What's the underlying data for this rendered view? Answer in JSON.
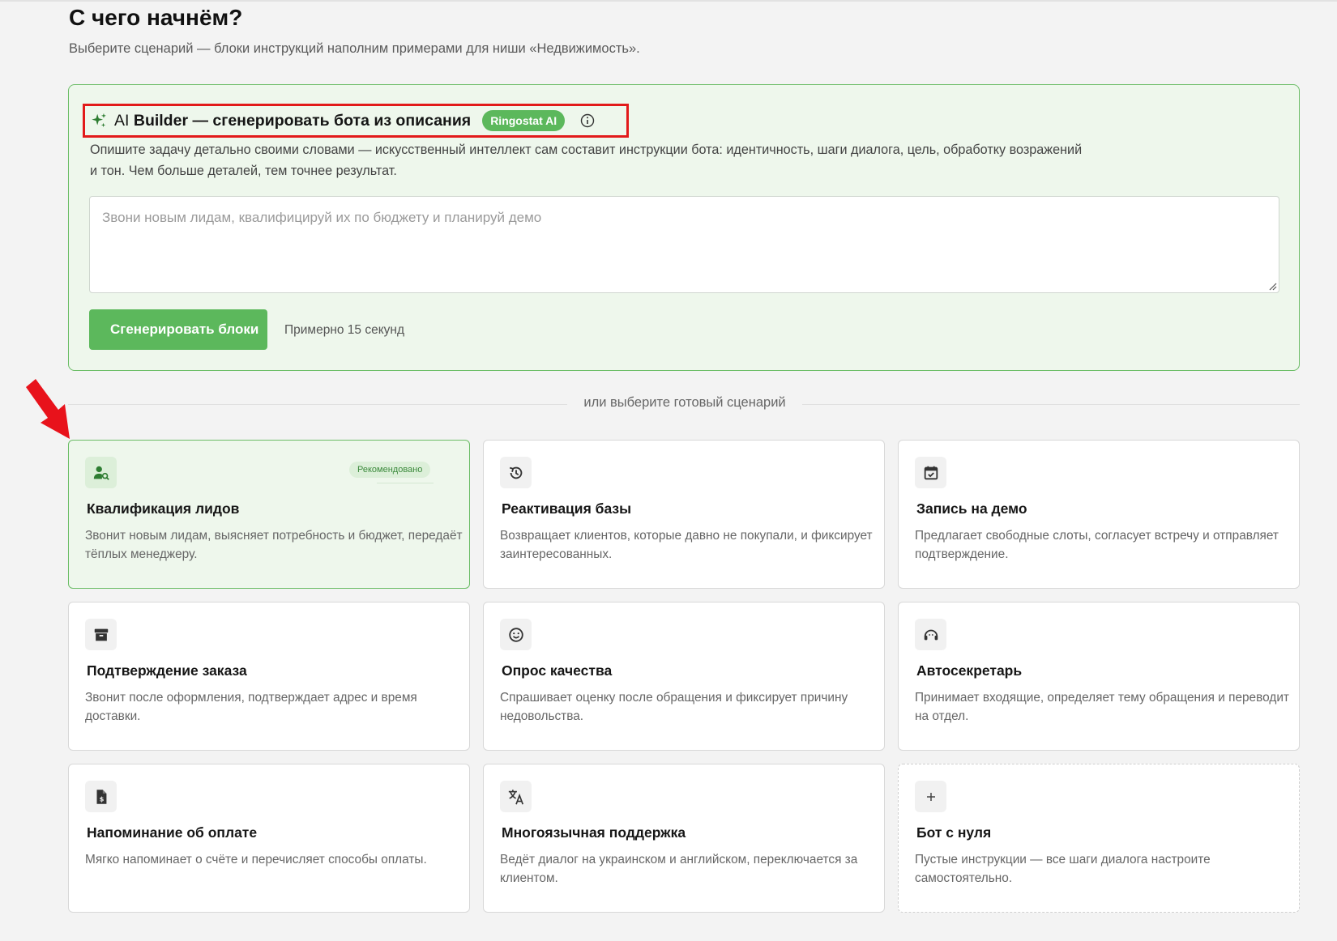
{
  "header": {
    "title": "С чего начнём?",
    "subtitle": "Выберите сценарий — блоки инструкций наполним примерами для ниши «Недвижимость»."
  },
  "ai_builder": {
    "title_prefix": "AI",
    "title_main": " Builder — сгенерировать бота из описания",
    "badge": "Ringostat AI",
    "icon": "sparkle-icon",
    "info_icon": "info-icon",
    "description": "Опишите задачу детально своими словами — искусственный интеллект сам составит инструкции бота: идентичность, шаги диалога, цель, обработку возражений и тон. Чем больше деталей, тем точнее результат.",
    "placeholder": "Звони новым лидам, квалифицируй их по бюджету и планируй демо",
    "value": "",
    "button_label": "Сгенерировать блоки",
    "hint": "Примерно 15 секунд",
    "accent_color": "#5cb85c",
    "highlight_color": "#e21a1a"
  },
  "divider": {
    "label": "или выберите готовый сценарий"
  },
  "scenarios": [
    {
      "title": "Квалификация лидов",
      "description": "Звонит новым лидам, выясняет потребность и бюджет, передаёт тёплых менеджеру.",
      "icon": "person-search-icon",
      "badge": "Рекомендовано"
    },
    {
      "title": "Реактивация базы",
      "description": "Возвращает клиентов, которые давно не покупали, и фиксирует заинтересованных.",
      "icon": "history-icon"
    },
    {
      "title": "Запись на демо",
      "description": "Предлагает свободные слоты, согласует встречу и отправляет подтверждение.",
      "icon": "calendar-check-icon"
    },
    {
      "title": "Подтверждение заказа",
      "description": "Звонит после оформления, подтверждает адрес и время доставки.",
      "icon": "archive-box-icon"
    },
    {
      "title": "Опрос качества",
      "description": "Спрашивает оценку после обращения и фиксирует причину недовольства.",
      "icon": "smiley-icon"
    },
    {
      "title": "Автосекретарь",
      "description": "Принимает входящие, определяет тему обращения и переводит на отдел.",
      "icon": "headset-icon"
    },
    {
      "title": "Напоминание об оплате",
      "description": "Мягко напоминает о счёте и перечисляет способы оплаты.",
      "icon": "invoice-dollar-icon"
    },
    {
      "title": "Многоязычная поддержка",
      "description": "Ведёт диалог на украинском и английском, переключается за клиентом.",
      "icon": "translate-icon"
    },
    {
      "title": "Бот с нуля",
      "description": "Пустые инструкции — все шаги диалога настроите самостоятельно.",
      "icon": "plus-icon"
    }
  ]
}
